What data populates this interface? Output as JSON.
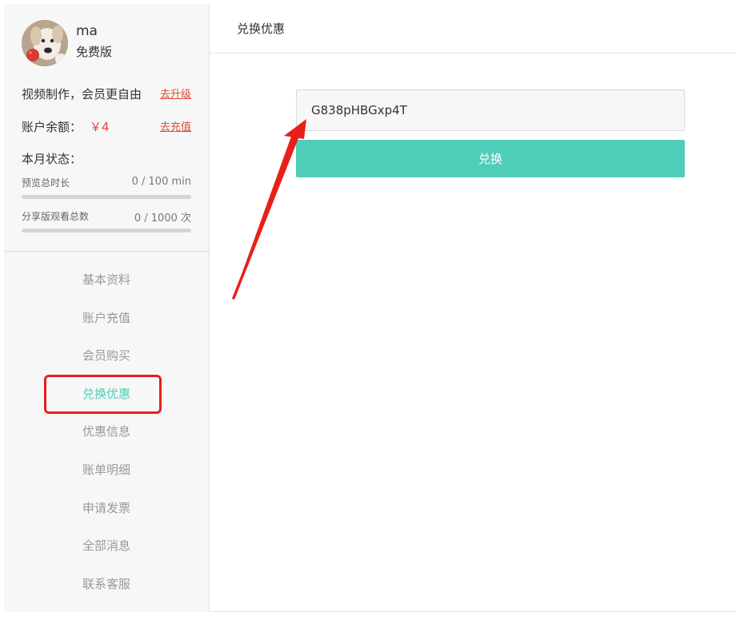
{
  "user": {
    "name": "ma",
    "plan": "免费版"
  },
  "account": {
    "upgrade_text": "视频制作，会员更自由",
    "upgrade_link": "去升级",
    "balance_label": "账户余额：",
    "balance_value": "￥4",
    "recharge_link": "去充值"
  },
  "monthly_status": {
    "title": "本月状态：",
    "meters": [
      {
        "label": "预览总时长",
        "value_text": "0 / 100 min",
        "fill_fraction": 0
      },
      {
        "label": "分享版观看总数",
        "value_text": "0 / 1000 次",
        "fill_fraction": 0
      }
    ]
  },
  "nav": {
    "items": [
      {
        "label": "基本资料",
        "active": false
      },
      {
        "label": "账户充值",
        "active": false
      },
      {
        "label": "会员购买",
        "active": false
      },
      {
        "label": "兑换优惠",
        "active": true
      },
      {
        "label": "优惠信息",
        "active": false
      },
      {
        "label": "账单明细",
        "active": false
      },
      {
        "label": "申请发票",
        "active": false
      },
      {
        "label": "全部消息",
        "active": false
      },
      {
        "label": "联系客服",
        "active": false
      }
    ]
  },
  "main": {
    "title": "兑换优惠",
    "code_value": "G838pHBGxp4T",
    "redeem_label": "兑换"
  },
  "colors": {
    "accent": "#4ecdb9",
    "link_red": "#e14b35",
    "annotation_red": "#e8201a"
  }
}
